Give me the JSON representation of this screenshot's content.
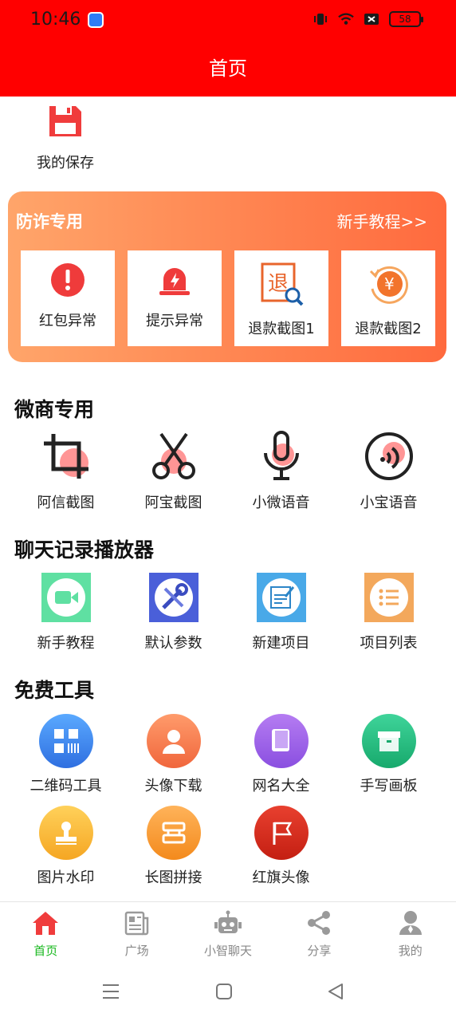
{
  "status_bar": {
    "time": "10:46",
    "battery": "58"
  },
  "header": {
    "title": "首页"
  },
  "save": {
    "label": "我的保存"
  },
  "promo": {
    "title": "防诈专用",
    "link": "新手教程>>",
    "cards": [
      {
        "label": "红包异常",
        "icon": "exclamation-circle-icon"
      },
      {
        "label": "提示异常",
        "icon": "alarm-light-icon"
      },
      {
        "label": "退款截图1",
        "icon": "refund-search-icon"
      },
      {
        "label": "退款截图2",
        "icon": "yen-refresh-icon"
      }
    ]
  },
  "sections": {
    "weishang": {
      "title": "微商专用",
      "items": [
        {
          "label": "阿信截图",
          "icon": "crop-icon"
        },
        {
          "label": "阿宝截图",
          "icon": "scissors-icon"
        },
        {
          "label": "小微语音",
          "icon": "microphone-icon"
        },
        {
          "label": "小宝语音",
          "icon": "sound-icon"
        }
      ]
    },
    "player": {
      "title": "聊天记录播放器",
      "items": [
        {
          "label": "新手教程",
          "icon": "video-camera-icon"
        },
        {
          "label": "默认参数",
          "icon": "tools-icon"
        },
        {
          "label": "新建项目",
          "icon": "edit-document-icon"
        },
        {
          "label": "项目列表",
          "icon": "list-icon"
        }
      ]
    },
    "free": {
      "title": "免费工具",
      "items": [
        {
          "label": "二维码工具",
          "icon": "qrcode-icon"
        },
        {
          "label": "头像下载",
          "icon": "user-icon"
        },
        {
          "label": "网名大全",
          "icon": "book-icon"
        },
        {
          "label": "手写画板",
          "icon": "box-icon"
        },
        {
          "label": "图片水印",
          "icon": "stamp-icon"
        },
        {
          "label": "长图拼接",
          "icon": "splice-icon"
        },
        {
          "label": "红旗头像",
          "icon": "flag-icon"
        }
      ]
    }
  },
  "bottom_nav": [
    {
      "label": "首页",
      "icon": "home-icon",
      "active": true
    },
    {
      "label": "广场",
      "icon": "newspaper-icon",
      "active": false
    },
    {
      "label": "小智聊天",
      "icon": "robot-icon",
      "active": false
    },
    {
      "label": "分享",
      "icon": "share-icon",
      "active": false
    },
    {
      "label": "我的",
      "icon": "profile-icon",
      "active": false
    }
  ],
  "colors": {
    "header": "#ff0000",
    "active_nav": "#19b81f",
    "icon_red": "#f03c3c"
  }
}
